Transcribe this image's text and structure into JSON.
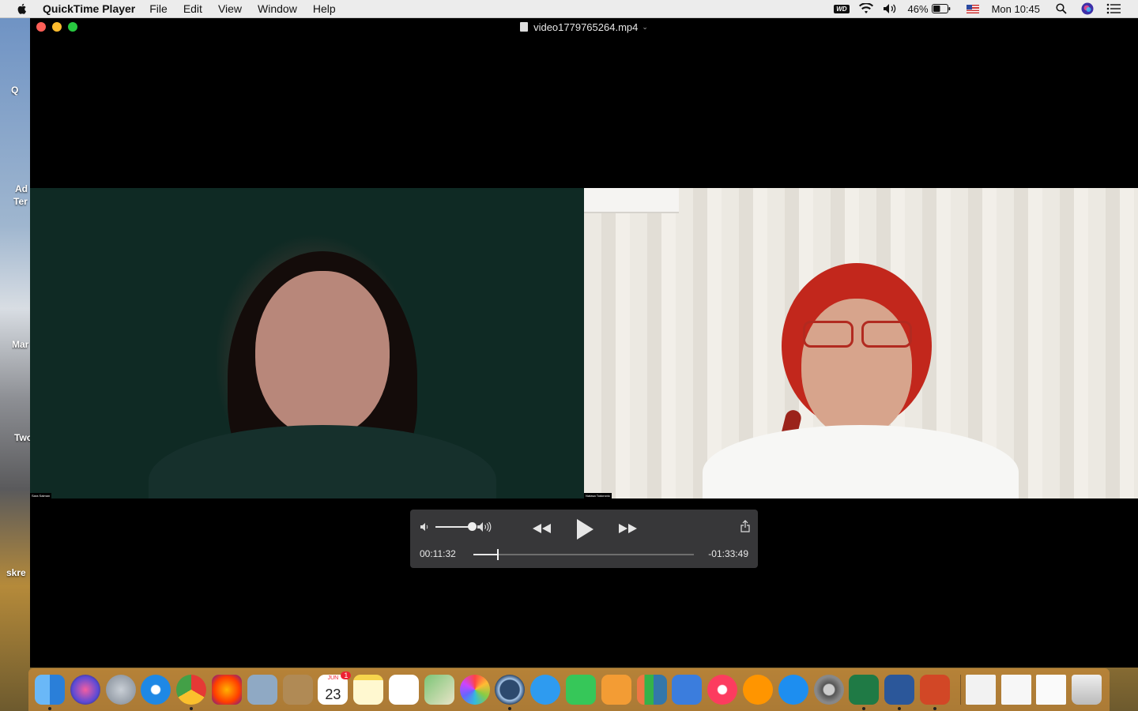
{
  "menubar": {
    "app_name": "QuickTime Player",
    "menus": [
      "File",
      "Edit",
      "View",
      "Window",
      "Help"
    ],
    "battery": "46%",
    "clock": "Mon 10:45",
    "wd_label": "WD"
  },
  "desktop": {
    "labels": [
      "Q",
      "Ad",
      "Ter",
      "Mar",
      "Two",
      "skre"
    ]
  },
  "window": {
    "title": "video1779765264.mp4"
  },
  "video": {
    "left_name_tag": "Sara Salman",
    "right_name_tag": "Natasa Todorovic"
  },
  "player": {
    "current_time": "00:11:32",
    "remaining_time": "-01:33:49",
    "progress_fraction": 0.11,
    "volume_fraction": 1.0
  },
  "dock": {
    "calendar_month": "JUN",
    "calendar_day": "23",
    "calendar_badge": "1",
    "colors": {
      "finder": "#3b8fe0",
      "siri": "#5b4ad6",
      "launchpad": "#9aa3ad",
      "safari": "#1e88e5",
      "chrome": "#e53935",
      "firefox": "#ff7a1a",
      "preview": "#c7b27a",
      "contacts": "#b08a55",
      "calendar": "#ffffff",
      "notes": "#ffe680",
      "reminders": "#ffffff",
      "maps": "#7cc576",
      "photos": "#f4f4f4",
      "quicktime": "#2d4a6e",
      "messages": "#2e9bf0",
      "facetime": "#36c759",
      "pages": "#f39c34",
      "numbers": "#35b24a",
      "keynote": "#3b7ddd",
      "music": "#fc3c5f",
      "books": "#ff9500",
      "appstore": "#1d8ef0",
      "syspref": "#7d7d7d",
      "excel": "#1f7a45",
      "word": "#2b579a",
      "powerpoint": "#d24726",
      "trash": "#d9d9d9"
    }
  }
}
